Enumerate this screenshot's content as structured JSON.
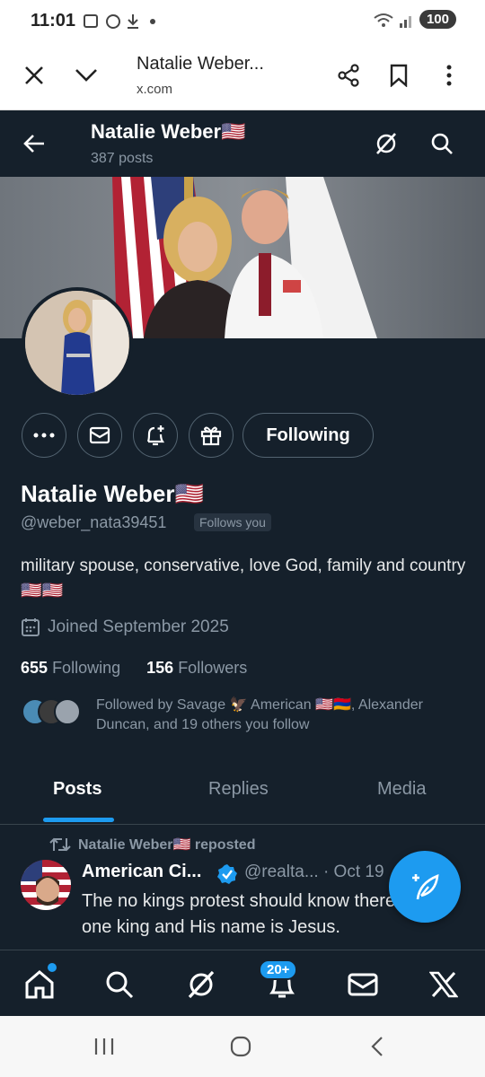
{
  "status_bar": {
    "time": "11:01",
    "battery": "100"
  },
  "browser": {
    "title": "Natalie Weber...",
    "url": "x.com"
  },
  "header": {
    "name": "Natalie Weber",
    "flag": "🇺🇸",
    "posts": "387 posts"
  },
  "profile": {
    "name": "Natalie Weber",
    "flag": "🇺🇸",
    "handle": "@weber_nata39451",
    "follows_you": "Follows you",
    "bio": "military spouse, conservative, love God, family and country 🇺🇸🇺🇸",
    "joined": "Joined September 2025",
    "following_count": "655",
    "following_label": "Following",
    "followers_count": "156",
    "followers_label": "Followers",
    "followed_by": "Followed by Savage 🦅 American 🇺🇸🇦🇲, Alexander Duncan, and 19 others you follow",
    "follow_button": "Following"
  },
  "tabs": [
    {
      "label": "Posts",
      "active": true
    },
    {
      "label": "Replies",
      "active": false
    },
    {
      "label": "Media",
      "active": false
    }
  ],
  "post": {
    "repost_by": "Natalie Weber🇺🇸 reposted",
    "author": "American Ci...",
    "handle": "@realta...",
    "date": "· Oct 19",
    "text": "The no kings protest should know there is only one king and His name is Jesus."
  },
  "bottom_nav": {
    "notification_badge": "20+"
  },
  "colors": {
    "accent": "#1d9bf0",
    "background": "#15202b",
    "muted": "#8b98a5"
  }
}
